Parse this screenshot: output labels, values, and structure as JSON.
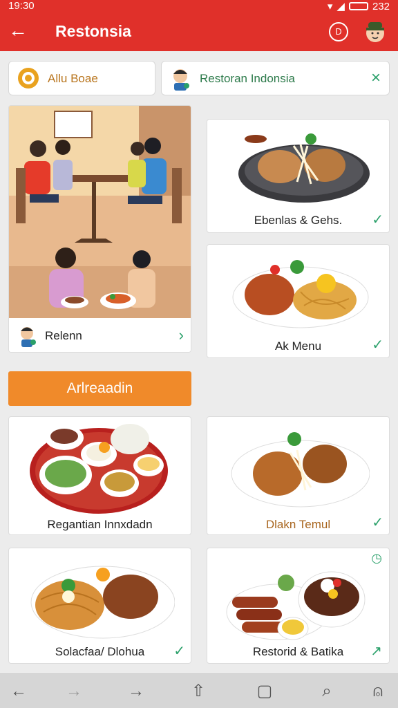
{
  "status": {
    "time": "19:30",
    "battery": "232"
  },
  "header": {
    "title": "Restonsia",
    "circle_icon": "D"
  },
  "chips": [
    {
      "label": "Allu Boae",
      "icon": "badge-icon"
    },
    {
      "label": "Restoran Indonsia",
      "icon": "chef-avatar-icon",
      "close": "×"
    }
  ],
  "feature": {
    "label": "Relenn"
  },
  "section": {
    "title": "Arlreaadin"
  },
  "cards": [
    {
      "label": "Ebenlas & Gehs."
    },
    {
      "label": "Ak Menu"
    },
    {
      "label": "Regantian Innxdadn"
    },
    {
      "label": "Dlakn Temul"
    },
    {
      "label": "Solacfaa/ Dlohua"
    },
    {
      "label": "Restorid & Batika"
    }
  ],
  "colors": {
    "primary": "#e0302a",
    "accent": "#f08a2a",
    "check": "#2aa06a"
  }
}
